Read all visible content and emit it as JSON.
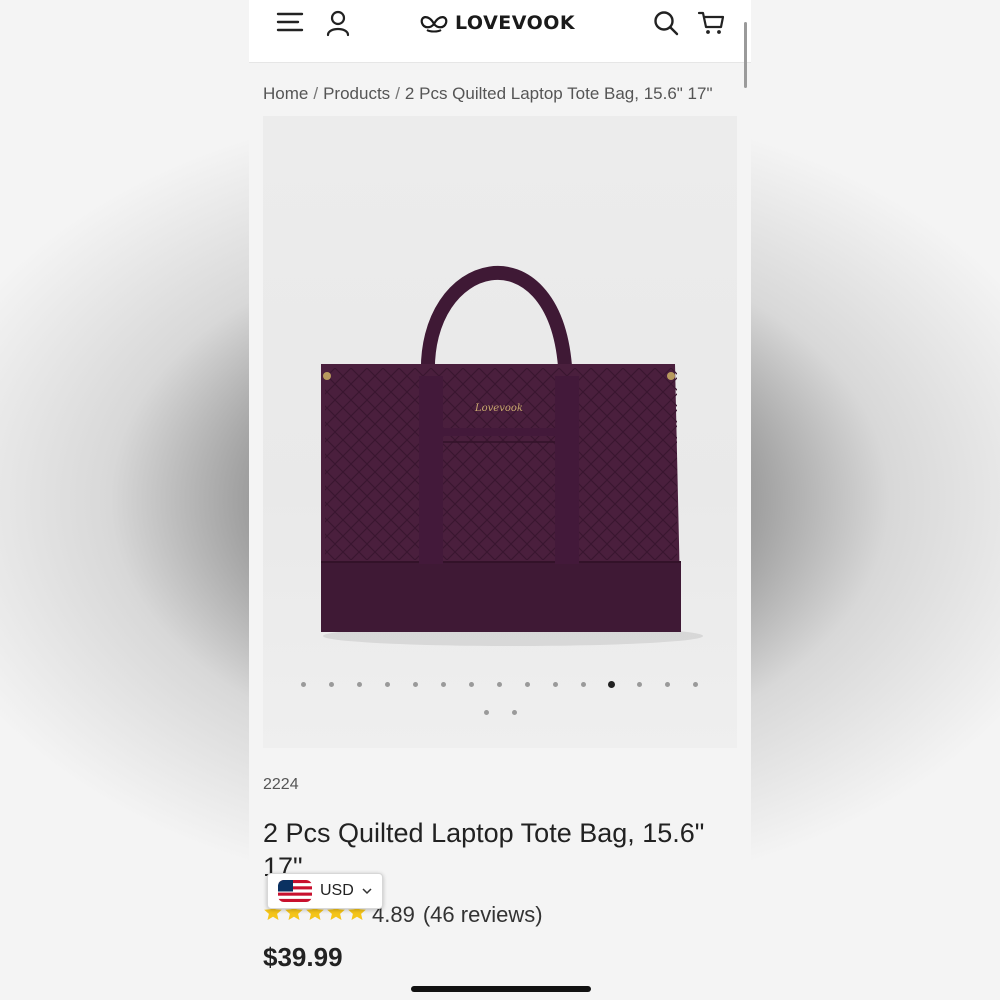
{
  "header": {
    "brand": "LOVEVOOK",
    "icons": [
      "menu-icon",
      "account-icon",
      "search-icon",
      "cart-icon"
    ]
  },
  "breadcrumb": {
    "items": [
      "Home",
      "Products",
      "2 Pcs Quilted Laptop Tote Bag, 15.6\" 17\""
    ],
    "separator": "/"
  },
  "gallery": {
    "dot_count": 17,
    "active_index": 11,
    "product_color": "#4a1f3d"
  },
  "product": {
    "sku": "2224",
    "title": "2 Pcs Quilted Laptop Tote Bag, 15.6\" 17\"",
    "rating": "4.89",
    "reviews": "(46 reviews)",
    "stars": 5,
    "price": "$39.99"
  },
  "currency_selector": {
    "code": "USD",
    "flag": "us-flag-icon"
  },
  "colors": {
    "star": "#f5c518",
    "text": "#222222"
  }
}
